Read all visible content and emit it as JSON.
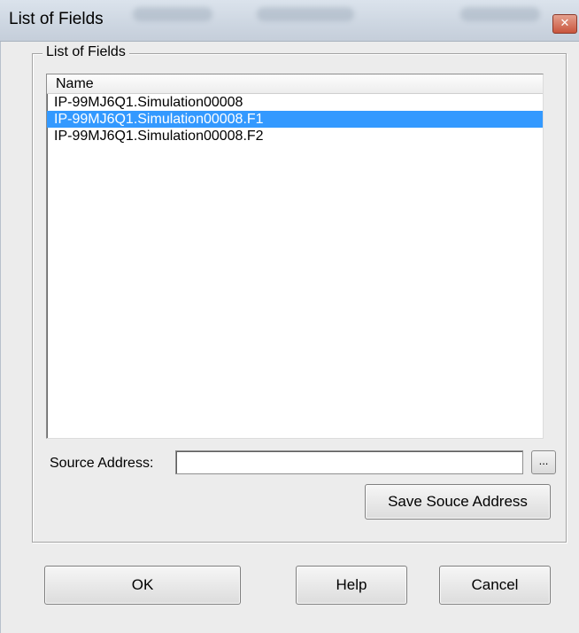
{
  "window": {
    "title": "List of Fields",
    "close_icon": "close-icon"
  },
  "group": {
    "label": "List of Fields"
  },
  "list": {
    "columns": [
      "Name"
    ],
    "rows": [
      "IP-99MJ6Q1.Simulation00008",
      "IP-99MJ6Q1.Simulation00008.F1",
      "IP-99MJ6Q1.Simulation00008.F2"
    ],
    "selected_index": 1
  },
  "source": {
    "label": "Source Address:",
    "value": "",
    "browse_label": "..."
  },
  "buttons": {
    "save": "Save Souce Address",
    "ok": "OK",
    "help": "Help",
    "cancel": "Cancel"
  },
  "colors": {
    "selection": "#3399ff"
  }
}
